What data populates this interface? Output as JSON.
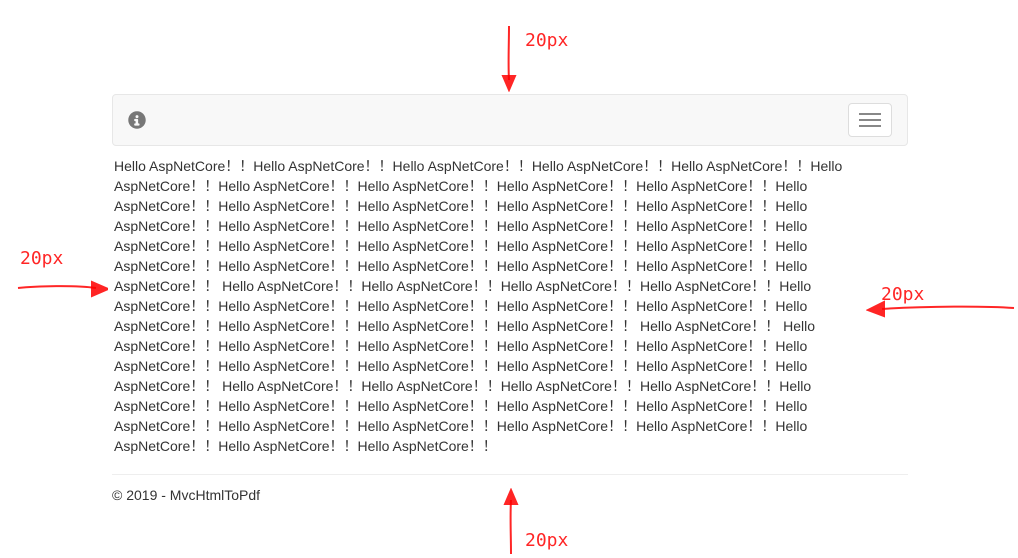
{
  "annotations": {
    "top": {
      "label": "20px"
    },
    "left": {
      "label": "20px"
    },
    "right": {
      "label": "20px"
    },
    "bottom": {
      "label": "20px"
    }
  },
  "navbar": {
    "info_icon": "info-icon",
    "toggle_label": "Toggle navigation"
  },
  "body_text": "Hello AspNetCore！！Hello AspNetCore！！Hello AspNetCore！！Hello AspNetCore！！Hello AspNetCore！！Hello AspNetCore！！Hello AspNetCore！！Hello AspNetCore！！Hello AspNetCore！！Hello AspNetCore！！Hello AspNetCore！！Hello AspNetCore！！Hello AspNetCore！！Hello AspNetCore！！Hello AspNetCore！！Hello AspNetCore！！Hello AspNetCore！！Hello AspNetCore！！Hello AspNetCore！！Hello AspNetCore！！Hello AspNetCore！！Hello AspNetCore！！Hello AspNetCore！！Hello AspNetCore！！Hello AspNetCore！！Hello AspNetCore！！Hello AspNetCore！！Hello AspNetCore！！Hello AspNetCore！！Hello AspNetCore！！Hello AspNetCore！！ Hello AspNetCore！！Hello AspNetCore！！Hello AspNetCore！！Hello AspNetCore！！Hello AspNetCore！！Hello AspNetCore！！Hello AspNetCore！！Hello AspNetCore！！Hello AspNetCore！！Hello AspNetCore！！Hello AspNetCore！！Hello AspNetCore！！Hello AspNetCore！！ Hello AspNetCore！！ Hello AspNetCore！！Hello AspNetCore！！Hello AspNetCore！！Hello AspNetCore！！Hello AspNetCore！！Hello AspNetCore！！Hello AspNetCore！！Hello AspNetCore！！Hello AspNetCore！！Hello AspNetCore！！Hello AspNetCore！！ Hello AspNetCore！！Hello AspNetCore！！Hello AspNetCore！！Hello AspNetCore！！Hello AspNetCore！！Hello AspNetCore！！Hello AspNetCore！！Hello AspNetCore！！Hello AspNetCore！！Hello AspNetCore！！Hello AspNetCore！！Hello AspNetCore！！Hello AspNetCore！！Hello AspNetCore！！Hello AspNetCore！！Hello AspNetCore！！Hello AspNetCore！！",
  "footer": {
    "text": "© 2019 - MvcHtmlToPdf"
  }
}
